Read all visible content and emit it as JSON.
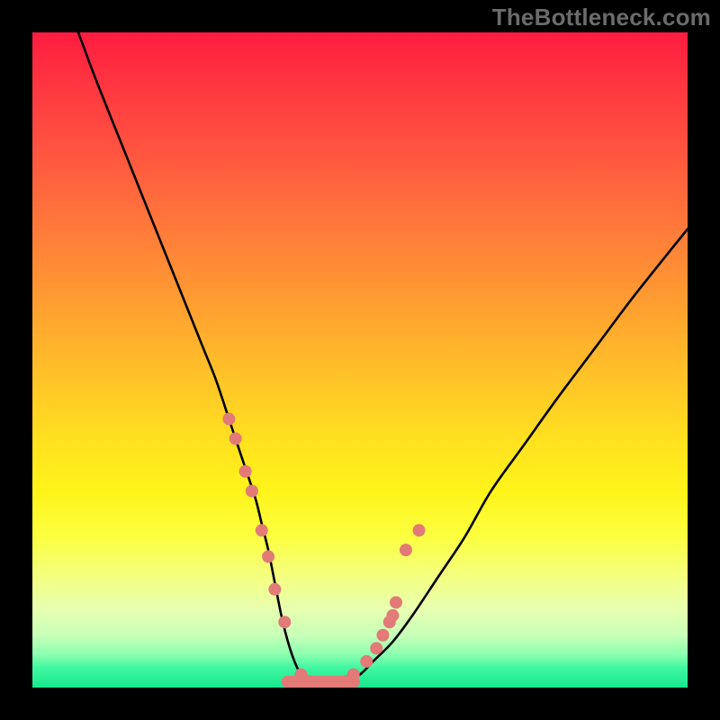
{
  "watermark": "TheBottleneck.com",
  "chart_data": {
    "type": "line",
    "title": "",
    "xlabel": "",
    "ylabel": "",
    "xlim": [
      0,
      100
    ],
    "ylim": [
      0,
      100
    ],
    "series": [
      {
        "name": "curve",
        "x": [
          7,
          10,
          14,
          18,
          22,
          26,
          28,
          30,
          32,
          34,
          35,
          36,
          37,
          38,
          39,
          40,
          41,
          42,
          43,
          44,
          45,
          46,
          48,
          50,
          52,
          55,
          58,
          62,
          66,
          70,
          75,
          80,
          86,
          92,
          100
        ],
        "y": [
          100,
          92,
          82,
          72,
          62,
          52,
          47,
          41,
          35,
          29,
          25,
          21,
          16,
          11,
          7,
          4,
          2,
          1,
          0,
          0,
          0,
          0,
          1,
          2,
          4,
          7,
          11,
          17,
          23,
          30,
          37,
          44,
          52,
          60,
          70
        ]
      }
    ],
    "markers": {
      "name": "dots",
      "x": [
        30,
        31,
        32.5,
        33.5,
        35,
        36,
        37,
        38.5,
        41,
        42,
        44,
        46,
        48,
        49,
        51,
        52.5,
        53.5,
        54.5,
        55,
        55.5,
        57,
        59
      ],
      "y": [
        41,
        38,
        33,
        30,
        24,
        20,
        15,
        10,
        2,
        1,
        0,
        0,
        1,
        2,
        4,
        6,
        8,
        10,
        11,
        13,
        21,
        24
      ],
      "color": "#e27a77",
      "radius_px": 7
    },
    "bottom_band": {
      "y": 0,
      "height_frac": 0.018,
      "color": "#e27a77"
    }
  }
}
